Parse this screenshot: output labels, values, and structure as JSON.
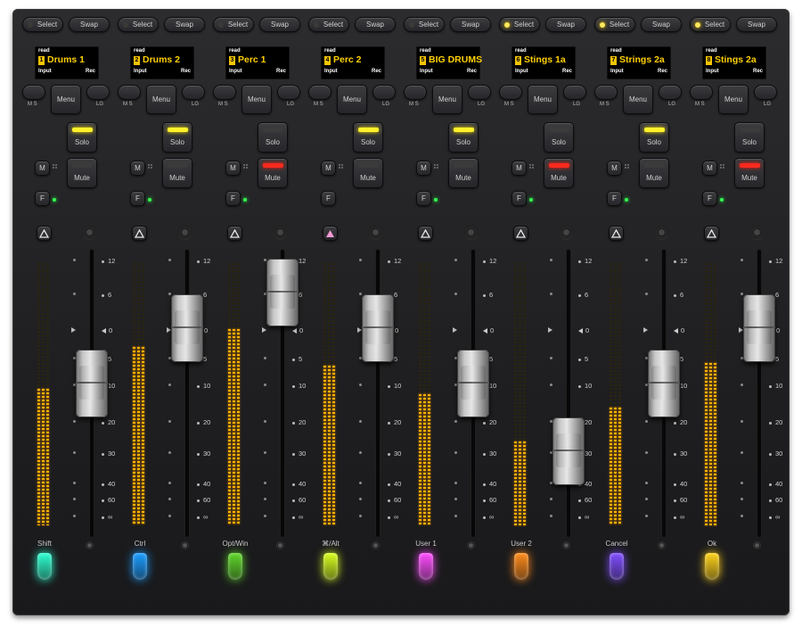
{
  "labels": {
    "select": "Select",
    "swap": "Swap",
    "menu": "Menu",
    "solo": "Solo",
    "mute": "Mute",
    "m_key": "M",
    "f_key": "F",
    "ms": "M S",
    "lg": "LG",
    "read": "read",
    "input": "Input",
    "rec": "Rec"
  },
  "scale": [
    "12",
    "6",
    "0",
    "5",
    "10",
    "20",
    "30",
    "40",
    "60",
    "∞"
  ],
  "accent": {
    "meter": "#ffb000",
    "display_text": "#ffd000",
    "solo_led": "#fff12c",
    "mute_led": "#ff2a1e",
    "status_led": "#34ff52"
  },
  "channels": [
    {
      "num": "1",
      "name": "Drums 1",
      "select_on": false,
      "solo_on": true,
      "mute_on": false,
      "fader_db": "10",
      "meter": 0.52,
      "automation_active": false,
      "status_led": true
    },
    {
      "num": "2",
      "name": "Drums 2",
      "select_on": false,
      "solo_on": true,
      "mute_on": false,
      "fader_db": "0",
      "meter": 0.68,
      "automation_active": false,
      "status_led": true
    },
    {
      "num": "3",
      "name": "Perc 1",
      "select_on": false,
      "solo_on": false,
      "mute_on": true,
      "fader_db": "6",
      "meter": 0.75,
      "automation_active": false,
      "status_led": true
    },
    {
      "num": "4",
      "name": "Perc 2",
      "select_on": false,
      "solo_on": true,
      "mute_on": false,
      "fader_db": "0",
      "meter": 0.61,
      "automation_active": true,
      "status_led": false
    },
    {
      "num": "5",
      "name": "BIG DRUMS",
      "select_on": false,
      "solo_on": true,
      "mute_on": false,
      "fader_db": "10",
      "meter": 0.5,
      "automation_active": false,
      "status_led": true
    },
    {
      "num": "6",
      "name": "Stings 1a",
      "select_on": true,
      "solo_on": false,
      "mute_on": true,
      "fader_db": "30",
      "meter": 0.32,
      "automation_active": false,
      "status_led": true
    },
    {
      "num": "7",
      "name": "Strings 2a",
      "select_on": true,
      "solo_on": true,
      "mute_on": false,
      "fader_db": "10",
      "meter": 0.45,
      "automation_active": false,
      "status_led": true
    },
    {
      "num": "8",
      "name": "Stings 2a",
      "select_on": true,
      "solo_on": false,
      "mute_on": true,
      "fader_db": "0",
      "meter": 0.62,
      "automation_active": false,
      "status_led": true
    }
  ],
  "function_keys": [
    {
      "label": "Shift",
      "color": "#2dffd0"
    },
    {
      "label": "Ctrl",
      "color": "#1a9cff"
    },
    {
      "label": "Opt/Win",
      "color": "#5fd62a"
    },
    {
      "label": "⌘/Alt",
      "color": "#d8ff1e"
    },
    {
      "label": "User 1",
      "color": "#ff4cff"
    },
    {
      "label": "User 2",
      "color": "#ff8a1a"
    },
    {
      "label": "Cancel",
      "color": "#7f4dff"
    },
    {
      "label": "Ok",
      "color": "#ffd21a"
    }
  ]
}
